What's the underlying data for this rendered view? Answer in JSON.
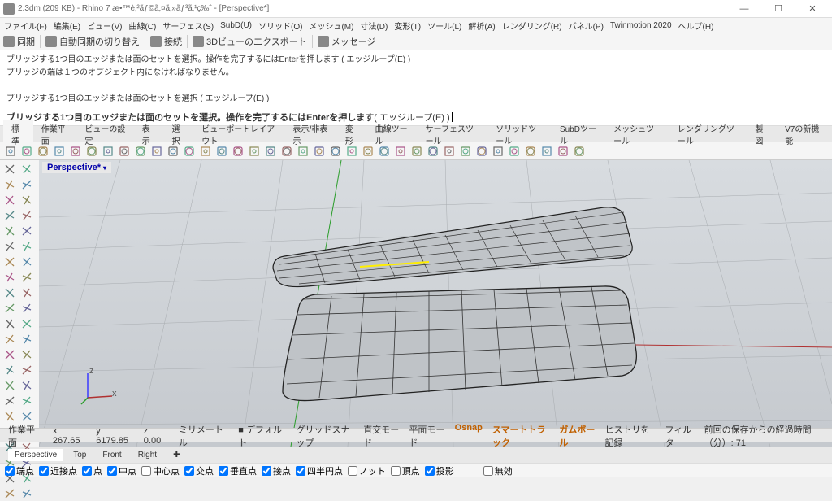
{
  "window": {
    "title": "2.3dm (209 KB) - Rhino 7 æ•™è‚²ãƒ©ã‚¤ã‚»ãƒ³ã‚¹ç‰ˆ - [Perspective*]",
    "btn_min": "―",
    "btn_max": "☐",
    "btn_close": "✕"
  },
  "menus": [
    "ファイル(F)",
    "編集(E)",
    "ビュー(V)",
    "曲線(C)",
    "サーフェス(S)",
    "SubD(U)",
    "ソリッド(O)",
    "メッシュ(M)",
    "寸法(D)",
    "変形(T)",
    "ツール(L)",
    "解析(A)",
    "レンダリング(R)",
    "パネル(P)",
    "Twinmotion 2020",
    "ヘルプ(H)"
  ],
  "toolbar1": [
    {
      "icon": "sync",
      "label": "同期"
    },
    {
      "icon": "autosync",
      "label": "自動同期の切り替え"
    },
    {
      "icon": "link",
      "label": "接続"
    },
    {
      "icon": "export",
      "label": "3Dビューのエクスポート"
    },
    {
      "icon": "msg",
      "label": "メッセージ"
    }
  ],
  "cmdhistory": [
    "ブリッジする1つ目のエッジまたは面のセットを選択。操作を完了するにはEnterを押します ( エッジループ(E) )",
    "ブリッジの端は１つのオブジェクト内になければなりません。",
    "",
    "ブリッジする1つ目のエッジまたは面のセットを選択 ( エッジループ(E) )"
  ],
  "cmdprompt": {
    "bold": "ブリッジする1つ目のエッジまたは面のセットを選択。操作を完了するにはEnterを押します",
    "rest": " ( エッジループ(E) )"
  },
  "tabs": [
    "標準",
    "作業平面",
    "ビューの設定",
    "表示",
    "選択",
    "ビューポートレイアウト",
    "表示/非表示",
    "変形",
    "曲線ツール",
    "サーフェスツール",
    "ソリッドツール",
    "SubDツール",
    "メッシュツール",
    "レンダリングツール",
    "製図",
    "V7の新機能"
  ],
  "viewport": {
    "label": "Perspective*"
  },
  "viewtabs": [
    "Perspective",
    "Top",
    "Front",
    "Right"
  ],
  "osnaps": [
    {
      "label": "端点",
      "checked": true
    },
    {
      "label": "近接点",
      "checked": true
    },
    {
      "label": "点",
      "checked": true
    },
    {
      "label": "中点",
      "checked": true
    },
    {
      "label": "中心点",
      "checked": false
    },
    {
      "label": "交点",
      "checked": true
    },
    {
      "label": "垂直点",
      "checked": true
    },
    {
      "label": "接点",
      "checked": true
    },
    {
      "label": "四半円点",
      "checked": true
    },
    {
      "label": "ノット",
      "checked": false
    },
    {
      "label": "頂点",
      "checked": false
    },
    {
      "label": "投影",
      "checked": true
    },
    {
      "label": "無効",
      "checked": false
    }
  ],
  "status": {
    "cplane": "作業平面",
    "x": "x 267.65",
    "y": "y 6179.85",
    "z": "z 0.00",
    "units": "ミリメートル",
    "layer": "デフォルト",
    "toggles": [
      "グリッドスナップ",
      "直交モード",
      "平面モード",
      "Osnap",
      "スマートトラック",
      "ガムボール",
      "ヒストリを記録",
      "フィルタ"
    ],
    "time": "前回の保存からの経過時間（分）: 71"
  }
}
